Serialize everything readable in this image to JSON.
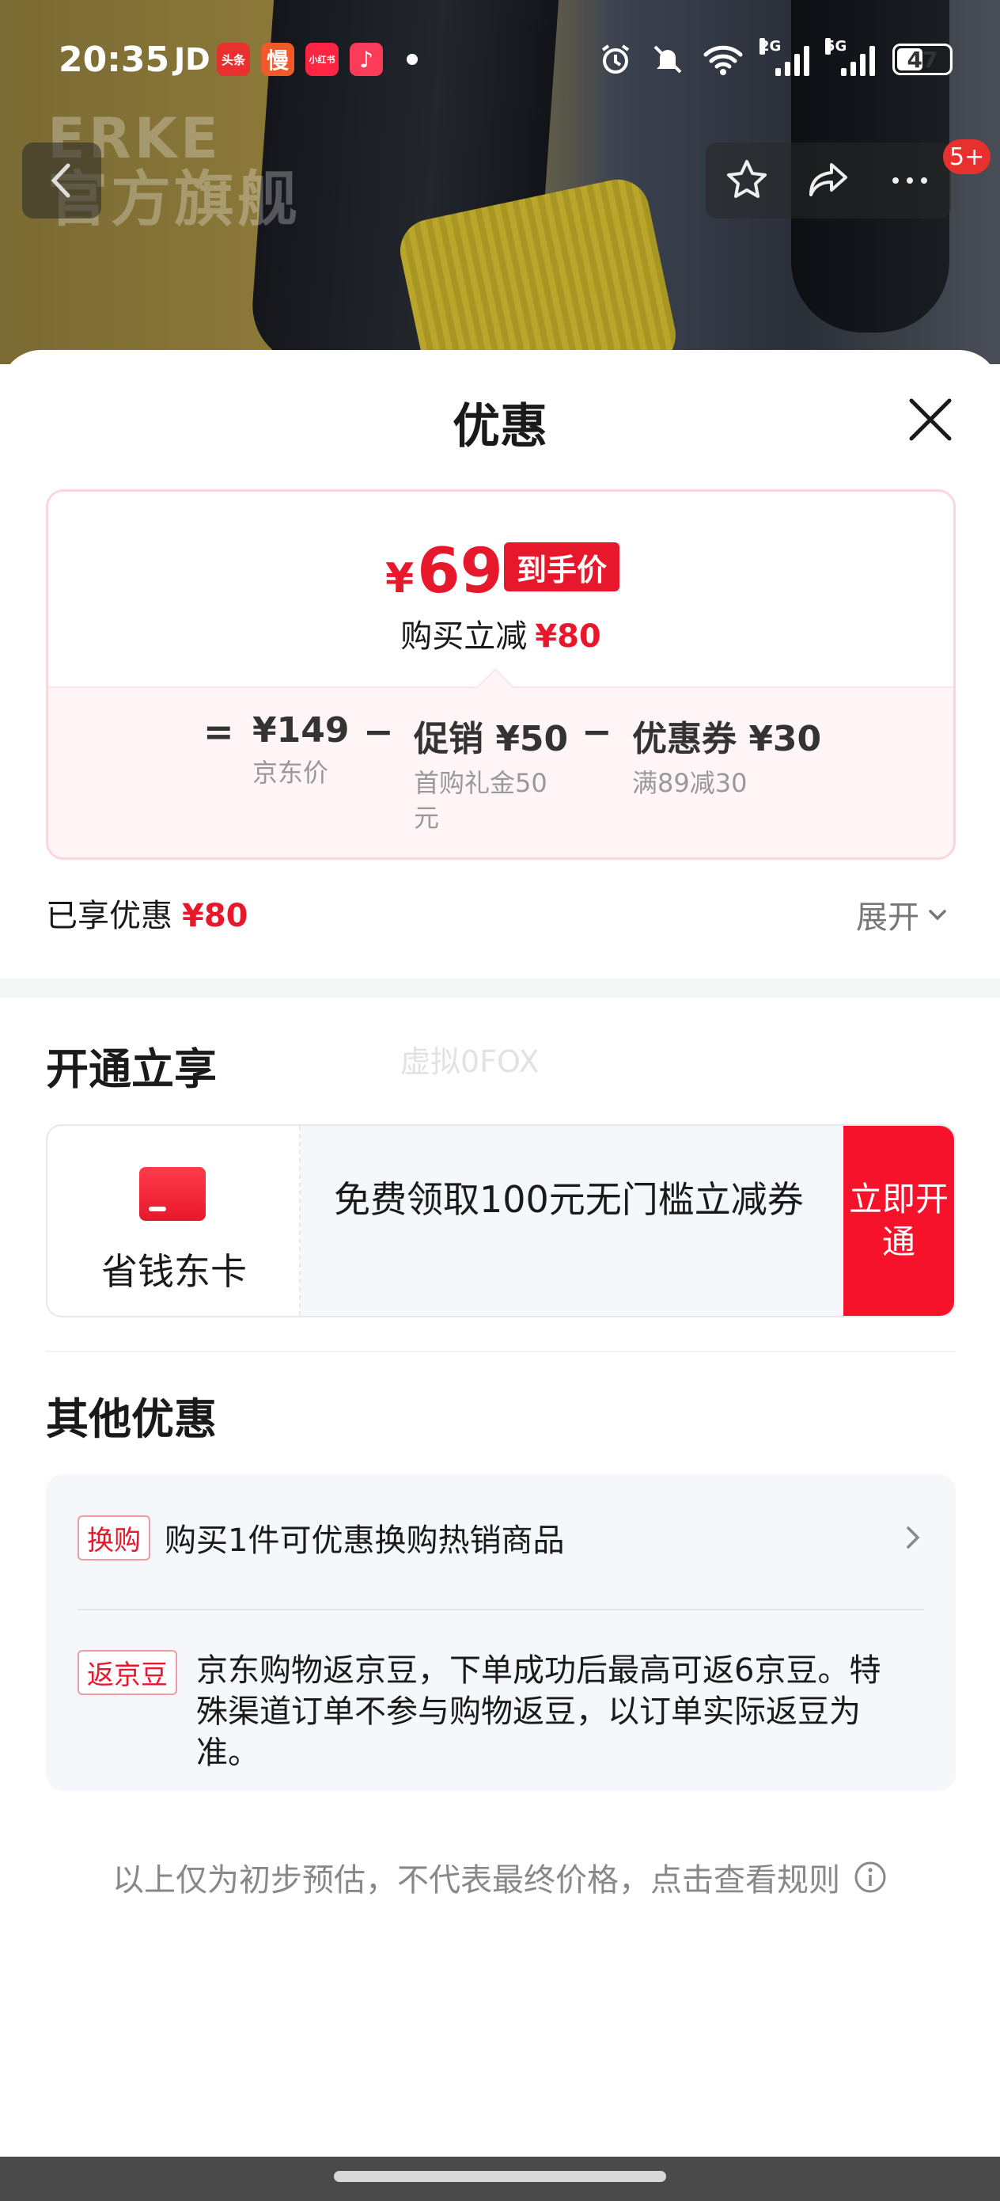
{
  "status_bar": {
    "time": "20:35",
    "carrier": "JD",
    "apps": [
      {
        "label": "头条",
        "color": "#e8312f"
      },
      {
        "label": "慢",
        "color": "#f05a28"
      },
      {
        "label": "小红书",
        "color": "#ff2442"
      },
      {
        "label": "♪",
        "color": "#fa3c58"
      }
    ],
    "signal_tags": [
      "2G",
      "5G"
    ],
    "battery": "47"
  },
  "brand_overlay": {
    "en": "ERKE",
    "cn": "官方旗舰"
  },
  "nav": {
    "badge": "5+"
  },
  "sheet": {
    "title": "优惠",
    "price": {
      "currency": "¥",
      "final": "69",
      "final_tag": "到手价",
      "reduce_label": "购买立减",
      "reduce_amount": "¥80",
      "formula": {
        "eq": "=",
        "minus": "−",
        "jd_price": "¥149",
        "jd_price_label": "京东价",
        "promo": "促销 ¥50",
        "promo_desc": "首购礼金50元",
        "coupon": "优惠券 ¥30",
        "coupon_desc": "满89减30"
      }
    },
    "enjoyed_label": "已享优惠",
    "enjoyed_amount": "¥80",
    "expand_label": "展开",
    "open_section": {
      "title": "开通立享",
      "watermark": "虚拟0FOX",
      "card_name": "省钱东卡",
      "description": "免费领取100元无门槛立减券",
      "button": "立即开通"
    },
    "other_section": {
      "title": "其他优惠",
      "items": [
        {
          "tag": "换购",
          "text": "购买1件可优惠换购热销商品"
        },
        {
          "tag": "返京豆",
          "text": "京东购物返京豆，下单成功后最高可返6京豆。特殊渠道订单不参与购物返豆，以订单实际返豆为准。"
        }
      ]
    },
    "footer_note": "以上仅为初步预估，不代表最终价格，点击查看规则"
  },
  "colors": {
    "accent": "#e8182c",
    "button": "#f5122a"
  }
}
